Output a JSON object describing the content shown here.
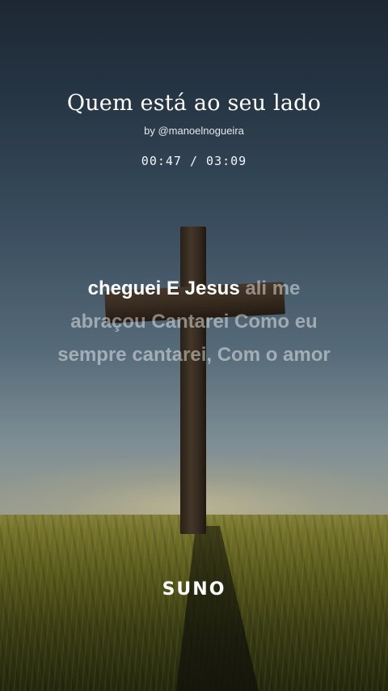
{
  "song": {
    "title": "Quem está ao seu lado",
    "author": "by @manoelnogueira",
    "time": "00:47 / 03:09"
  },
  "lyrics": {
    "line1_sung": "cheguei E Jesus",
    "line1_rest": " ali me",
    "line2": "abraçou Cantarei  Como eu",
    "line3": "sempre cantarei, Com o amor"
  },
  "brand": {
    "logo": "SUNO"
  }
}
